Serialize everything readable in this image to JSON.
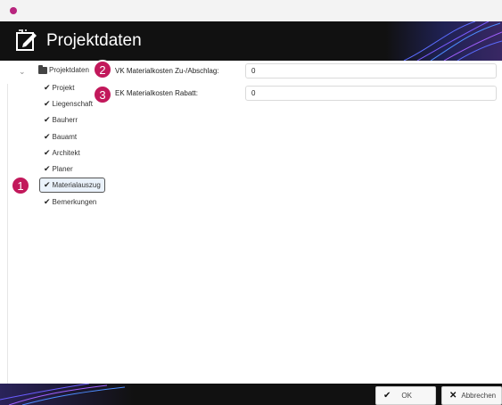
{
  "window": {
    "app_icon": "app-circle-icon"
  },
  "header": {
    "title": "Projektdaten",
    "icon": "edit-document-icon"
  },
  "tree": {
    "root_label": "Projektdaten",
    "items": [
      {
        "label": "Projekt"
      },
      {
        "label": "Liegenschaft"
      },
      {
        "label": "Bauherr"
      },
      {
        "label": "Bauamt"
      },
      {
        "label": "Architekt"
      },
      {
        "label": "Planer"
      },
      {
        "label": "Materialauszug",
        "selected": true
      },
      {
        "label": "Bemerkungen"
      }
    ]
  },
  "badges": [
    "1",
    "2",
    "3"
  ],
  "form": {
    "fields": [
      {
        "label": "VK Materialkosten Zu-/Abschlag:",
        "value": "0"
      },
      {
        "label": "EK Materialkosten Rabatt:",
        "value": "0"
      }
    ]
  },
  "footer": {
    "ok_label": "OK",
    "cancel_label": "Abbrechen"
  },
  "colors": {
    "badge": "#c2185b",
    "header_bg": "#111111",
    "selected_bg": "#eaf2fb"
  }
}
